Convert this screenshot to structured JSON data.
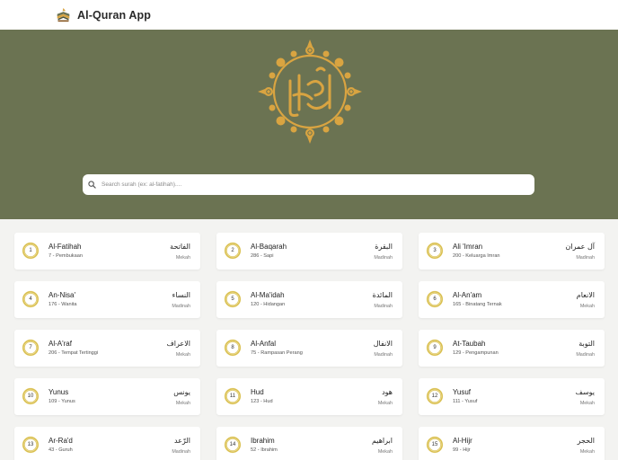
{
  "app": {
    "title": "Al-Quran App",
    "logo_icon": "quran-book-icon"
  },
  "search": {
    "placeholder": "Search surah (ex: al-fatihah)....",
    "value": "",
    "icon": "search-icon"
  },
  "colors": {
    "hero_bg": "#6b7352",
    "gold": "#d9a441",
    "badge_ring": "#d8bd4c",
    "page_bg": "#f3f3f1"
  },
  "surahs": [
    {
      "number": "1",
      "name": "Al-Fatihah",
      "meta": "7 - Pembukaan",
      "arabic": "الفاتحة",
      "place": "Mekah"
    },
    {
      "number": "2",
      "name": "Al-Baqarah",
      "meta": "286 - Sapi",
      "arabic": "البقرة",
      "place": "Madinah"
    },
    {
      "number": "3",
      "name": "Ali 'Imran",
      "meta": "200 - Keluarga Imran",
      "arabic": "آل عمران",
      "place": "Madinah"
    },
    {
      "number": "4",
      "name": "An-Nisa'",
      "meta": "176 - Wanita",
      "arabic": "النساء",
      "place": "Madinah"
    },
    {
      "number": "5",
      "name": "Al-Ma'idah",
      "meta": "120 - Hidangan",
      "arabic": "المائدة",
      "place": "Madinah"
    },
    {
      "number": "6",
      "name": "Al-An'am",
      "meta": "165 - Binatang Ternak",
      "arabic": "الانعام",
      "place": "Mekah"
    },
    {
      "number": "7",
      "name": "Al-A'raf",
      "meta": "206 - Tempat Tertinggi",
      "arabic": "الاعراف",
      "place": "Mekah"
    },
    {
      "number": "8",
      "name": "Al-Anfal",
      "meta": "75 - Rampasan Perang",
      "arabic": "الانفال",
      "place": "Madinah"
    },
    {
      "number": "9",
      "name": "At-Taubah",
      "meta": "129 - Pengampunan",
      "arabic": "التوبة",
      "place": "Madinah"
    },
    {
      "number": "10",
      "name": "Yunus",
      "meta": "109 - Yunus",
      "arabic": "يونس",
      "place": "Mekah"
    },
    {
      "number": "11",
      "name": "Hud",
      "meta": "123 - Hud",
      "arabic": "هود",
      "place": "Mekah"
    },
    {
      "number": "12",
      "name": "Yusuf",
      "meta": "111 - Yusuf",
      "arabic": "يوسف",
      "place": "Mekah"
    },
    {
      "number": "13",
      "name": "Ar-Ra'd",
      "meta": "43 - Guruh",
      "arabic": "الرّعد",
      "place": "Madinah"
    },
    {
      "number": "14",
      "name": "Ibrahim",
      "meta": "52 - Ibrahim",
      "arabic": "ابراهيم",
      "place": "Mekah"
    },
    {
      "number": "15",
      "name": "Al-Hijr",
      "meta": "99 - Hijr",
      "arabic": "الحجر",
      "place": "Mekah"
    }
  ]
}
